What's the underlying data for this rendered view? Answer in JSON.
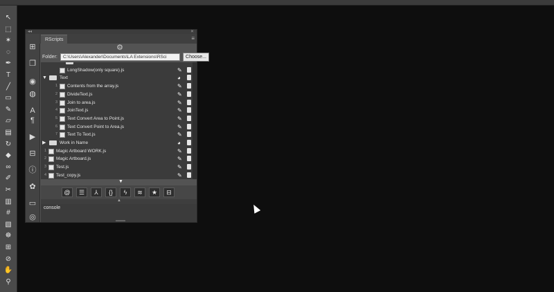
{
  "toolbar": {
    "tools": [
      {
        "name": "move-tool",
        "glyph": "↖"
      },
      {
        "name": "artboard-tool",
        "glyph": "⬚"
      },
      {
        "name": "magic-wand-tool",
        "glyph": "✶"
      },
      {
        "name": "lasso-tool",
        "glyph": "◌"
      },
      {
        "name": "pen-tool",
        "glyph": "✒"
      },
      {
        "name": "text-tool",
        "glyph": "T"
      },
      {
        "name": "line-tool",
        "glyph": "╱"
      },
      {
        "name": "marquee-tool",
        "glyph": "▭"
      },
      {
        "name": "brush-tool",
        "glyph": "✎"
      },
      {
        "name": "eraser-tool",
        "glyph": "▱"
      },
      {
        "name": "gradient-tool",
        "glyph": "▤"
      },
      {
        "name": "rotate-tool",
        "glyph": "↻"
      },
      {
        "name": "shape-tool",
        "glyph": "◆"
      },
      {
        "name": "blend-tool",
        "glyph": "∞"
      },
      {
        "name": "eyedropper-tool",
        "glyph": "✐"
      },
      {
        "name": "scissors-tool",
        "glyph": "✂"
      },
      {
        "name": "chart-tool",
        "glyph": "▥"
      },
      {
        "name": "mesh-tool",
        "glyph": "#"
      },
      {
        "name": "fill-tool",
        "glyph": "▧"
      },
      {
        "name": "symbol-tool",
        "glyph": "☸"
      },
      {
        "name": "grid-tool",
        "glyph": "⊞"
      },
      {
        "name": "slice-tool",
        "glyph": "⊘"
      },
      {
        "name": "hand-tool",
        "glyph": "✋"
      },
      {
        "name": "zoom-tool",
        "glyph": "⚲"
      }
    ]
  },
  "panel": {
    "tab_title": "RScripts",
    "folder_label": "Folder:",
    "folder_path": "C:\\Users\\Alexander\\Documents\\LA Extensions\\RSci",
    "choose_label": "Choose...",
    "rows": [
      {
        "num": "",
        "label": "",
        "kind": "partial"
      },
      {
        "num": "",
        "label": "LongShadow(only square).js",
        "kind": "file",
        "indent": 1
      },
      {
        "num": "",
        "label": "Text",
        "kind": "folder",
        "open": true
      },
      {
        "num": "1",
        "label": "Contents from the array.js",
        "kind": "file",
        "indent": 1
      },
      {
        "num": "2",
        "label": "DivideText.js",
        "kind": "file",
        "indent": 1
      },
      {
        "num": "3",
        "label": "Join to area.js",
        "kind": "file",
        "indent": 1
      },
      {
        "num": "4",
        "label": "JoinText.js",
        "kind": "file",
        "indent": 1
      },
      {
        "num": "5",
        "label": "Text Convert Area to Point.js",
        "kind": "file",
        "indent": 1
      },
      {
        "num": "6",
        "label": "Text Convert Point to Area.js",
        "kind": "file",
        "indent": 1
      },
      {
        "num": "7",
        "label": "Text To Text.js",
        "kind": "file",
        "indent": 1
      },
      {
        "num": "",
        "label": "Work in Name",
        "kind": "folder",
        "open": false
      },
      {
        "num": "1",
        "label": "Magic Artboard WORK.js",
        "kind": "file",
        "indent": 0
      },
      {
        "num": "2",
        "label": "Magic Artboard.js",
        "kind": "file",
        "indent": 0
      },
      {
        "num": "3",
        "label": "Test.js",
        "kind": "file",
        "indent": 0
      },
      {
        "num": "4",
        "label": "Test_copy.js",
        "kind": "file",
        "indent": 0
      }
    ],
    "bottom_tools": [
      "@",
      "☰",
      "⅄",
      "{}",
      "ϟ",
      "≋",
      "★",
      "⊟"
    ],
    "console_label": "console"
  }
}
